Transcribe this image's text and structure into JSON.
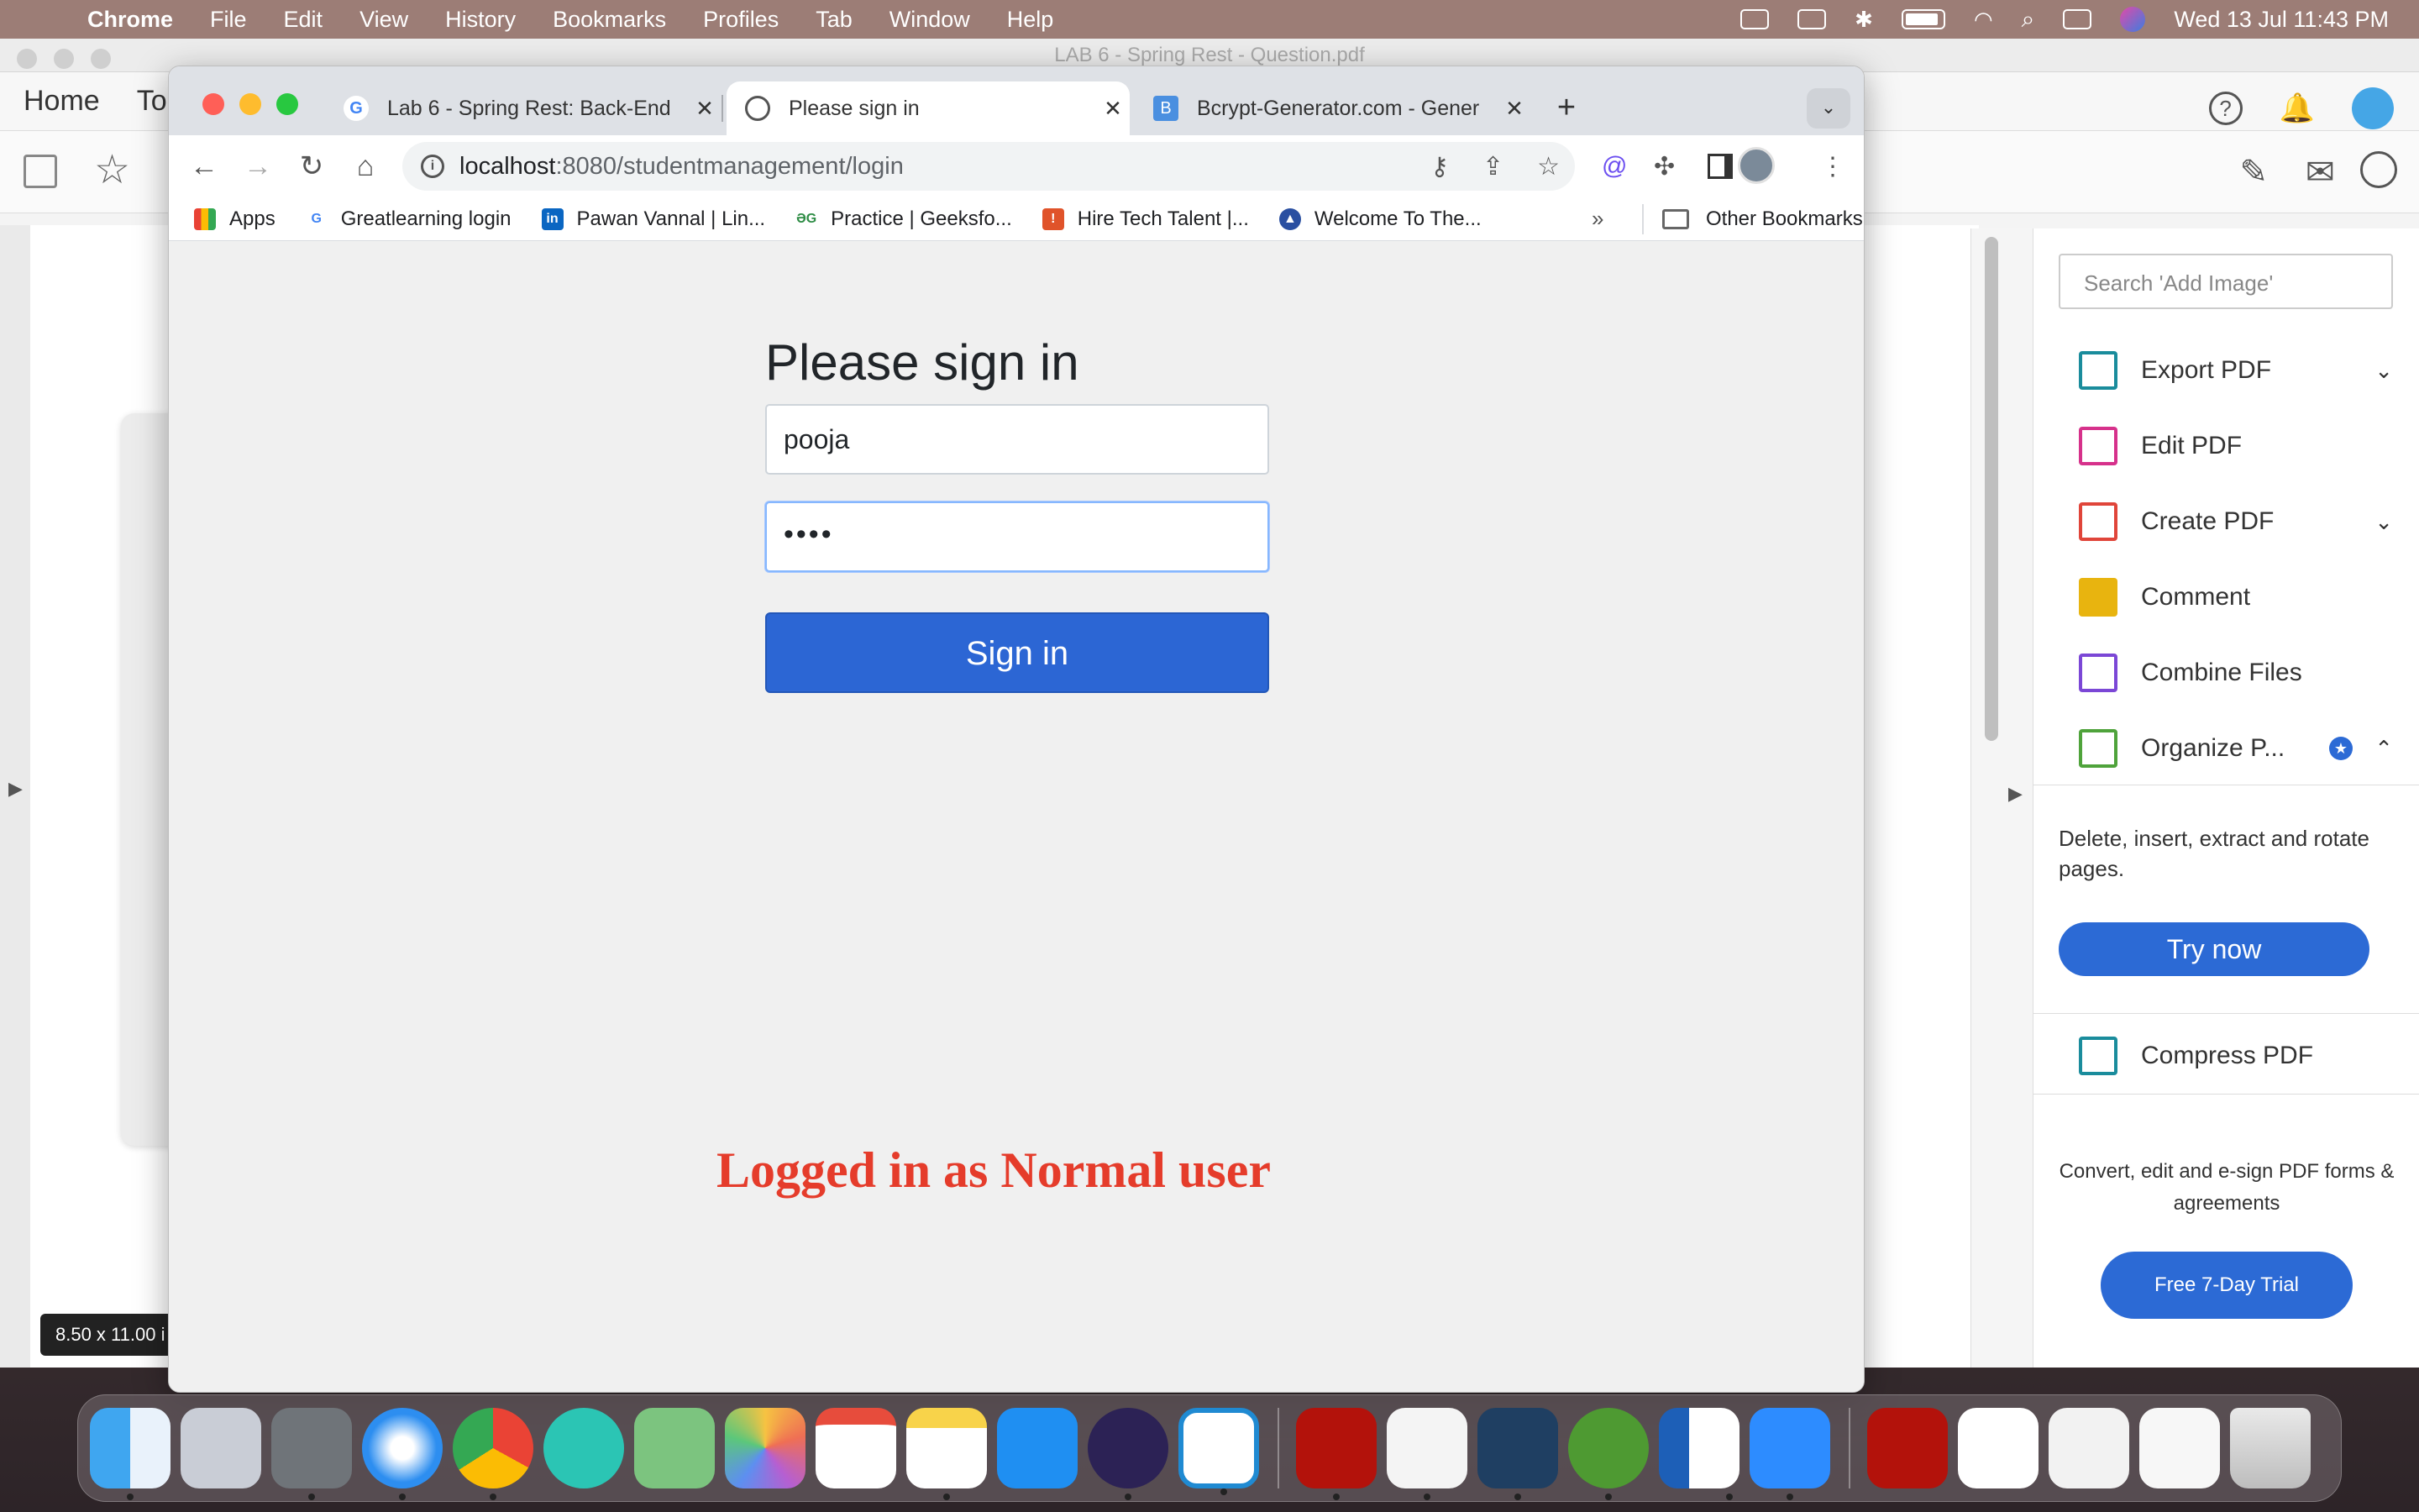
{
  "menubar": {
    "app": "Chrome",
    "items": [
      "File",
      "Edit",
      "View",
      "History",
      "Bookmarks",
      "Profiles",
      "Tab",
      "Window",
      "Help"
    ],
    "clock": "Wed 13 Jul  11:43 PM"
  },
  "acrobat": {
    "title": "LAB 6 - Spring Rest - Question.pdf",
    "nav_home": "Home",
    "nav_tools": "To",
    "size_badge": "8.50 x 11.00 i",
    "search_placeholder": "Search 'Add Image'",
    "tools": [
      {
        "label": "Export PDF",
        "icon": "export-pdf-icon",
        "color": "#1a8c9c"
      },
      {
        "label": "Edit PDF",
        "icon": "edit-pdf-icon",
        "color": "#d6318b"
      },
      {
        "label": "Create PDF",
        "icon": "create-pdf-icon",
        "color": "#e0453a"
      },
      {
        "label": "Comment",
        "icon": "comment-icon",
        "color": "#e8b40f"
      },
      {
        "label": "Combine Files",
        "icon": "combine-files-icon",
        "color": "#7b47d6"
      },
      {
        "label": "Organize P...",
        "icon": "organize-pages-icon",
        "color": "#4fa33b"
      }
    ],
    "organize_desc": "Delete, insert, extract and rotate pages.",
    "try_now": "Try now",
    "compress": "Compress PDF",
    "promo": "Convert, edit and e-sign PDF forms & agreements",
    "trial": "Free 7-Day Trial"
  },
  "chrome": {
    "tabs": [
      {
        "title": "Lab 6 - Spring Rest: Back-End",
        "favicon": "G",
        "active": false
      },
      {
        "title": "Please sign in",
        "favicon": "globe",
        "active": true
      },
      {
        "title": "Bcrypt-Generator.com - Gener",
        "favicon": "B",
        "active": false
      }
    ],
    "url_host": "localhost",
    "url_path": ":8080/studentmanagement/login",
    "bookmarks": [
      {
        "label": "Apps",
        "icon": "apps-icon",
        "color": "#e94235"
      },
      {
        "label": "Greatlearning login",
        "icon": "G",
        "color": "#4285f4"
      },
      {
        "label": "Pawan Vannal | Lin...",
        "icon": "in",
        "color": "#0a66c2"
      },
      {
        "label": "Practice | Geeksfo...",
        "icon": "GG",
        "color": "#2f8d46"
      },
      {
        "label": "Hire Tech Talent |...",
        "icon": "H",
        "color": "#e0532a"
      },
      {
        "label": "Welcome To The...",
        "icon": "W",
        "color": "#2a4fa1"
      }
    ],
    "bookmarks_more": "»",
    "other_bookmarks": "Other Bookmarks"
  },
  "page": {
    "heading": "Please sign in",
    "username_value": "pooja",
    "password_mask": "••••",
    "signin_button": "Sign in",
    "annotation": "Logged in as Normal user"
  }
}
